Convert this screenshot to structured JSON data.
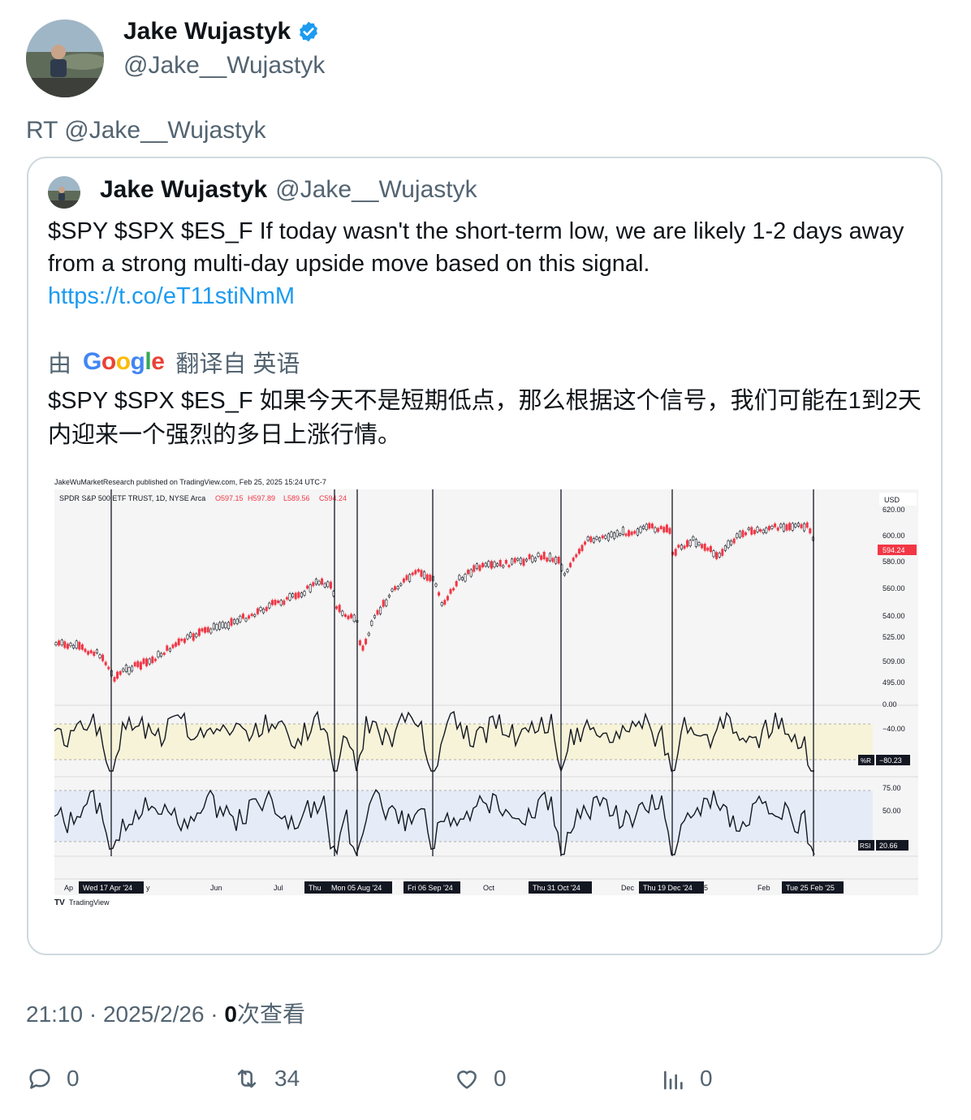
{
  "author": {
    "name": "Jake Wujastyk",
    "handle": "@Jake__Wujastyk",
    "verified_color": "#1d9bf0"
  },
  "retweet_label": "RT @Jake__Wujastyk",
  "quoted": {
    "name": "Jake Wujastyk",
    "handle": "@Jake__Wujastyk",
    "text": "$SPY $SPX $ES_F If today wasn't the short-term low, we are likely 1-2 days away from a strong multi-day upside move based on this signal.",
    "link": "https://t.co/eT11stiNmM",
    "translation": {
      "by": "由",
      "provider": "Google",
      "from": "翻译自 英语",
      "text": "$SPY $SPX $ES_F 如果今天不是短期低点，那么根据这个信号，我们可能在1到2天内迎来一个强烈的多日上涨行情。"
    }
  },
  "chart": {
    "header": "JakeWuMarketResearch published on TradingView.com, Feb 25, 2025 15:24 UTC-7",
    "symbol": "SPDR S&P 500 ETF TRUST, 1D, NYSE Arca",
    "ohlc": {
      "o": "O597.15",
      "h": "H597.89",
      "l": "L589.56",
      "c": "C594.24"
    },
    "currency": "USD",
    "last_price": "594.24",
    "wr_label": "%R",
    "wr_value": "−80.23",
    "rsi_label": "RSI",
    "rsi_value": "20.66",
    "tradingview": "TradingView",
    "price_ticks": [
      "620.00",
      "600.00",
      "580.00",
      "560.00",
      "540.00",
      "525.00",
      "509.00",
      "495.00"
    ],
    "wr_ticks": [
      "0.00",
      "−40.00"
    ],
    "rsi_ticks": [
      "75.00",
      "50.00"
    ],
    "month_labels": [
      "Ap",
      "y",
      "Jun",
      "Jul",
      "Oct",
      "Dec",
      "5",
      "Feb"
    ],
    "signal_dates": [
      "Wed 17 Apr '24",
      "Thu",
      "Mon 05 Aug '24",
      "Fri 06 Sep '24",
      "Thu 31 Oct '24",
      "Thu 19 Dec '24",
      "Tue 25 Feb '25"
    ]
  },
  "meta": {
    "time": "21:10 · 2025/2/26 · ",
    "views_count": "0",
    "views_label": "次查看"
  },
  "actions": {
    "replies": "0",
    "retweets": "34",
    "likes": "0",
    "views": "0"
  }
}
